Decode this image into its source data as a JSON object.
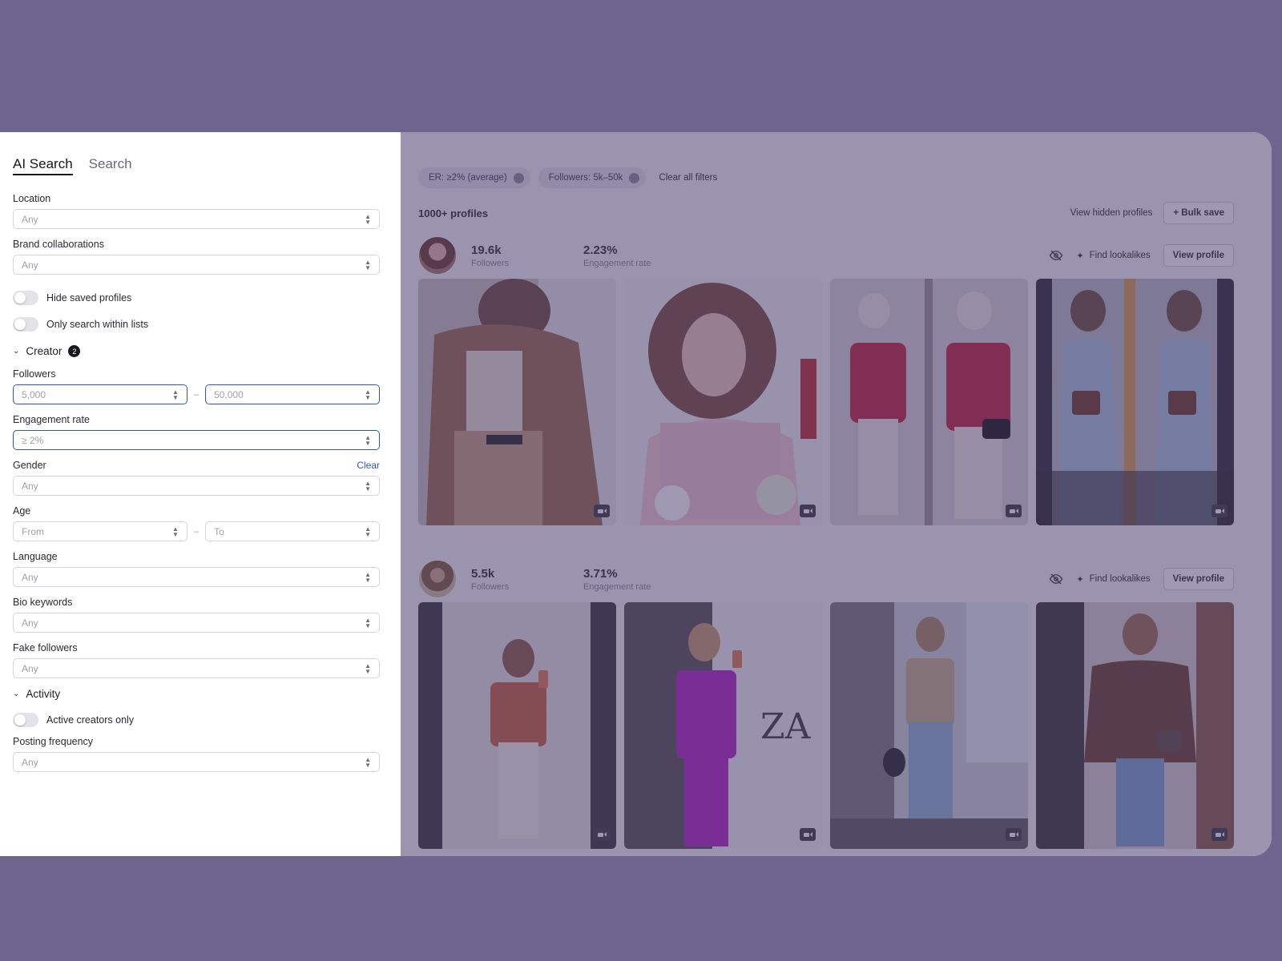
{
  "sidebar": {
    "tabs": [
      {
        "label": "AI Search",
        "active": true
      },
      {
        "label": "Search",
        "active": false
      }
    ],
    "location": {
      "label": "Location",
      "value": "Any"
    },
    "brand_collaborations": {
      "label": "Brand collaborations",
      "value": "Any"
    },
    "toggles": {
      "hide_saved": "Hide saved profiles",
      "only_lists": "Only search within lists",
      "active_only": "Active creators only"
    },
    "creator_section": {
      "label": "Creator",
      "badge": "2"
    },
    "followers": {
      "label": "Followers",
      "min": "5,000",
      "max": "50,000",
      "separator": "–"
    },
    "engagement_rate": {
      "label": "Engagement rate",
      "value": "≥ 2%"
    },
    "gender": {
      "label": "Gender",
      "clear_label": "Clear",
      "value": "Any"
    },
    "age": {
      "label": "Age",
      "from": "From",
      "to": "To",
      "separator": "–"
    },
    "language": {
      "label": "Language",
      "value": "Any"
    },
    "bio_keywords": {
      "label": "Bio keywords",
      "value": "Any"
    },
    "fake_followers": {
      "label": "Fake followers",
      "value": "Any"
    },
    "activity_section": {
      "label": "Activity"
    },
    "posting_frequency": {
      "label": "Posting frequency",
      "value": "Any"
    }
  },
  "filters": {
    "chips": [
      "ER: ≥2% (average)",
      "Followers: 5k–50k"
    ],
    "clear_all": "Clear all filters"
  },
  "results": {
    "count": "1000+ profiles",
    "view_hidden": "View hidden profiles",
    "bulk_save": "+ Bulk save",
    "find_lookalikes": "Find lookalikes",
    "view_profile": "View profile",
    "profiles": [
      {
        "followers": "19.6k",
        "followers_label": "Followers",
        "er": "2.23%",
        "er_label": "Engagement rate"
      },
      {
        "followers": "5.5k",
        "followers_label": "Followers",
        "er": "3.71%",
        "er_label": "Engagement rate"
      }
    ]
  },
  "colors": {
    "page_bg": "#6f668f",
    "accent": "#2f56c8",
    "overlay": "rgba(70,60,110,0.52)"
  },
  "icons": [
    "chevron-down-icon",
    "up-down-arrows-icon",
    "eye-off-icon",
    "sparkle-icon",
    "video-icon",
    "close-icon"
  ]
}
